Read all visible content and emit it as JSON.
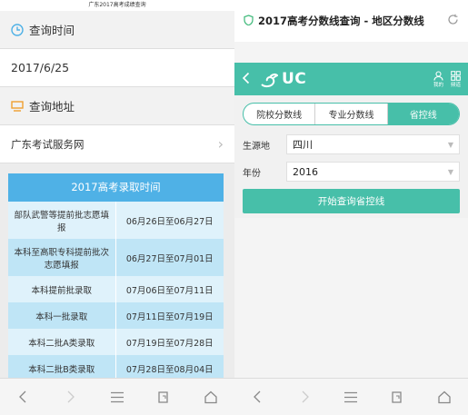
{
  "left": {
    "top_caption": "广东2017高考成绩查询",
    "time_heading": "查询时间",
    "time_value": "2017/6/25",
    "address_heading": "查询地址",
    "address_link": "广东考试服务网",
    "admission": {
      "title": "2017高考录取时间",
      "rows": [
        {
          "batch": "部队武警等提前批志愿填报",
          "period": "06月26日至06月27日"
        },
        {
          "batch": "本科至高职专科提前批次志愿填报",
          "period": "06月27日至07月01日"
        },
        {
          "batch": "本科提前批录取",
          "period": "07月06日至07月11日"
        },
        {
          "batch": "本科一批录取",
          "period": "07月11日至07月19日"
        },
        {
          "batch": "本科二批A类录取",
          "period": "07月19日至07月28日"
        },
        {
          "batch": "本科二批B类录取",
          "period": "07月28日至08月04日"
        }
      ]
    }
  },
  "right": {
    "page_title": "2017高考分数线查询 - 地区分数线",
    "brand": "UC",
    "mine_label": "我的",
    "more_label": "频道",
    "tabs": [
      "院校分数线",
      "专业分数线",
      "省控线"
    ],
    "active_tab": "省控线",
    "origin_label": "生源地",
    "origin_value": "四川",
    "year_label": "年份",
    "year_value": "2016",
    "query_button": "开始查询省控线"
  },
  "colors": {
    "accent_teal": "#47bfa9",
    "table_blue": "#4fb1e6",
    "row_light": "#dff2fb",
    "row_dark": "#bfe5f6"
  }
}
